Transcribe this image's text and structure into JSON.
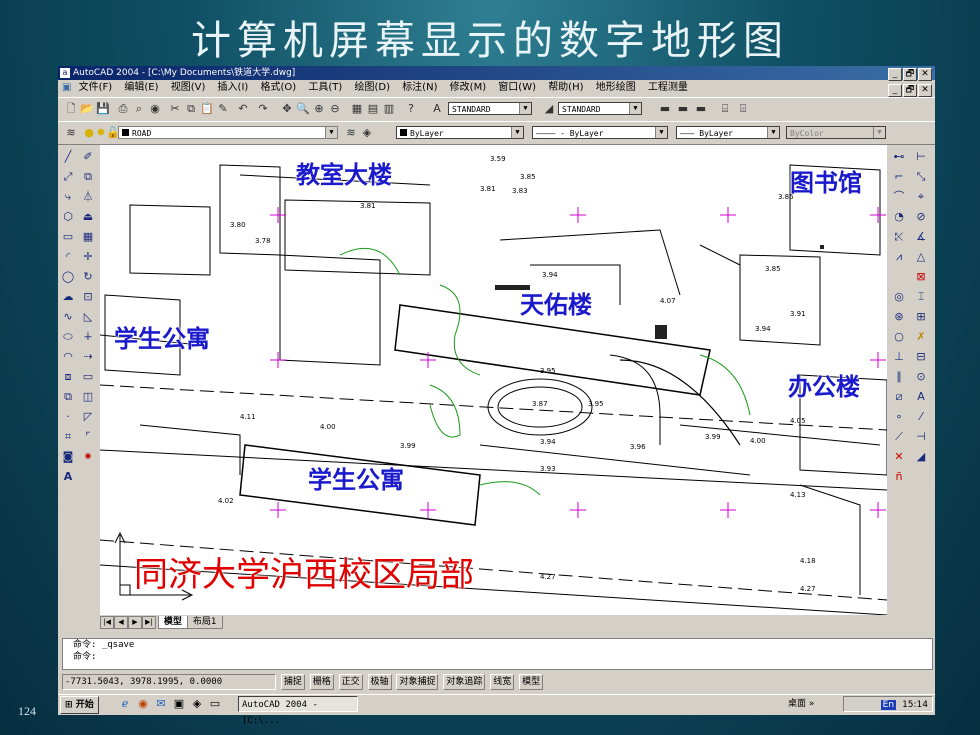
{
  "slide": {
    "title": "计算机屏幕显示的数字地形图",
    "page_number": "124"
  },
  "window": {
    "title": "AutoCAD 2004 - [C:\\My Documents\\铁道大学.dwg]",
    "controls": [
      "_",
      "🗗",
      "✕"
    ]
  },
  "menu": [
    "文件(F)",
    "编辑(E)",
    "视图(V)",
    "插入(I)",
    "格式(O)",
    "工具(T)",
    "绘图(D)",
    "标注(N)",
    "修改(M)",
    "窗口(W)",
    "帮助(H)",
    "地形绘图",
    "工程测量"
  ],
  "toolbar": {
    "text_style": "STANDARD",
    "dim_style": "STANDARD",
    "layer": "ROAD",
    "color": "ByLayer",
    "linetype": "ByLayer",
    "lineweight": "ByLayer",
    "plot_style": "ByColor"
  },
  "map_labels": {
    "classroom": "教室大楼",
    "library": "图书馆",
    "tianyou": "天佑楼",
    "dorm_west": "学生公寓",
    "office": "办公楼",
    "dorm_south": "学生公寓",
    "campus": "同济大学沪西校区局部"
  },
  "elevations": [
    "3.59",
    "3.85",
    "3.81",
    "3.83",
    "3.81",
    "3.80",
    "3.78",
    "3.86",
    "3.85",
    "3.94",
    "3.91",
    "4.07",
    "3.94",
    "3.95",
    "3.87",
    "3.95",
    "3.94",
    "3.96",
    "3.99",
    "4.00",
    "4.05",
    "3.99",
    "3.93",
    "4.11",
    "4.00",
    "4.02",
    "4.13",
    "4.18",
    "4.27",
    "4.27"
  ],
  "layout_tabs": {
    "model": "模型",
    "layout1": "布局1"
  },
  "command": {
    "line1": "命令: _qsave",
    "line2": "命令:"
  },
  "status": {
    "coords": "-7731.5043, 3978.1995, 0.0000",
    "buttons": [
      "捕捉",
      "栅格",
      "正交",
      "极轴",
      "对象捕捉",
      "对象追踪",
      "线宽",
      "模型"
    ]
  },
  "taskbar": {
    "start": "开始",
    "task": "AutoCAD 2004 - [C:\\...",
    "desktop": "桌面 »",
    "clock": "15:14",
    "ime": "En"
  },
  "colors": {
    "label_blue": "#1a1acc",
    "label_red": "#e00000",
    "titlebar": "#0a246a"
  }
}
